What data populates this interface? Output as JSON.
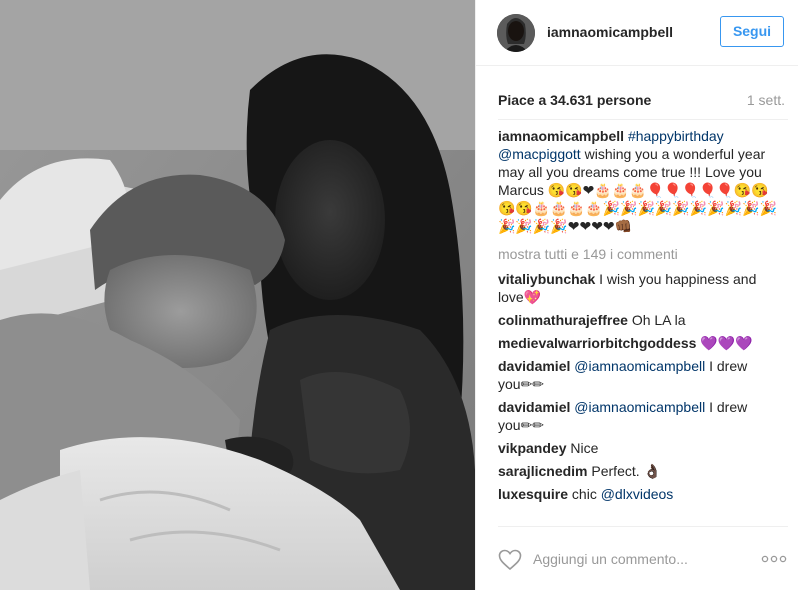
{
  "post": {
    "username": "iamnaomicampbell",
    "follow_label": "Segui",
    "likes": "Piace a 34.631 persone",
    "time": "1 sett.",
    "caption": {
      "user": "iamnaomicampbell",
      "hashtag": "#happybirthday",
      "mention": "@macpiggott",
      "text": "wishing you a wonderful year may all you dreams come true !!! Love you Marcus 😘😘❤🎂🎂🎂🎈🎈🎈🎈🎈😘😘😘😘🎂🎂🎂🎂🎉🎉🎉🎉🎉🎉🎉🎉🎉🎉🎉🎉🎉🎉❤❤❤❤👊🏾"
    },
    "show_all": "mostra tutti e 149 i commenti",
    "comments": [
      {
        "user": "vitaliybunchak",
        "text": "I wish you happiness and love💖"
      },
      {
        "user": "colinmathurajeffree",
        "text": "Oh LA la"
      },
      {
        "user": "medievalwarriorbitchgoddess",
        "text": "💜💜💜"
      },
      {
        "user": "davidamiel",
        "mention": "@iamnaomicampbell",
        "text": "I drew you✏✏"
      },
      {
        "user": "davidamiel",
        "mention": "@iamnaomicampbell",
        "text": "I drew you✏✏"
      },
      {
        "user": "vikpandey",
        "text": "Nice"
      },
      {
        "user": "sarajlicnedim",
        "text": "Perfect. 👌🏿"
      },
      {
        "user": "luxesquire",
        "text": "chic",
        "mention": "@dlxvideos"
      }
    ],
    "comment_placeholder": "Aggiungi un commento...",
    "icons": {
      "like": "heart-icon",
      "options": "more-options-icon"
    },
    "colors": {
      "link_blue": "#3897f0",
      "tag_navy": "#003569",
      "muted": "#999999",
      "text": "#262626"
    }
  }
}
